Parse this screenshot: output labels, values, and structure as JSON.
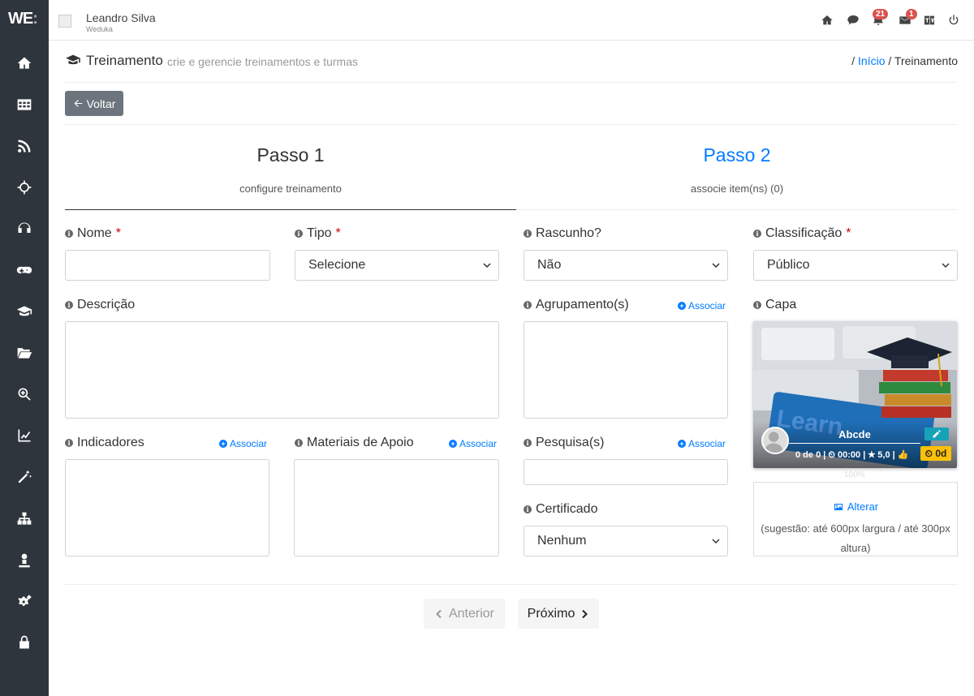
{
  "brand": {
    "logo_text": "WE",
    "logo_dot": ":"
  },
  "user": {
    "name": "Leandro Silva",
    "org": "Weduka"
  },
  "topbar": {
    "icons": [
      "home-icon",
      "chat-icon",
      "bell-icon",
      "mail-icon",
      "translate-icon",
      "power-icon"
    ],
    "notifications_count": "21",
    "messages_count": "1"
  },
  "sidebar": {
    "icons": [
      "home-icon",
      "table-icon",
      "rss-icon",
      "crosshairs-icon",
      "headset-icon",
      "gamepad-icon",
      "graduation-cap-icon",
      "folder-open-icon",
      "search-plus-icon",
      "chart-line-icon",
      "magic-wand-icon",
      "sitemap-icon",
      "user-icon",
      "cogs-icon",
      "lock-icon"
    ]
  },
  "header": {
    "title": "Treinamento",
    "subtitle": "crie e gerencie treinamentos e turmas",
    "breadcrumb_sep": "/",
    "breadcrumb_home": "Início",
    "breadcrumb_current": "Treinamento"
  },
  "back_button": "Voltar",
  "steps": [
    {
      "title": "Passo 1",
      "subtitle": "configure treinamento"
    },
    {
      "title": "Passo 2",
      "subtitle": "associe item(ns) (0)"
    }
  ],
  "form": {
    "nome_label": "Nome",
    "tipo_label": "Tipo",
    "tipo_value": "Selecione",
    "rascunho_label": "Rascunho?",
    "rascunho_value": "Não",
    "classificacao_label": "Classificação",
    "classificacao_value": "Público",
    "descricao_label": "Descrição",
    "agrupamento_label": "Agrupamento(s)",
    "capa_label": "Capa",
    "indicadores_label": "Indicadores",
    "materiais_label": "Materiais de Apoio",
    "pesquisa_label": "Pesquisa(s)",
    "certificado_label": "Certificado",
    "certificado_value": "Nenhum",
    "associar": "Associar",
    "required_mark": "*"
  },
  "cover": {
    "course_name": "Abcde",
    "meta": "0 de 0 | ⏲ 00:00 | ★ 5,0 | 👍",
    "time_badge": "⏲ 0d",
    "progress": "100%",
    "image_word": "Learn"
  },
  "alterar": {
    "label": "Alterar",
    "hint": "(sugestão: até 600px largura / até 300px altura)"
  },
  "nav": {
    "prev": "Anterior",
    "next": "Próximo"
  },
  "colors": {
    "sidebar": "#2f353d",
    "accent": "#007bff",
    "badge": "#d9534f",
    "warning": "#ffc107",
    "info": "#17a2b8"
  }
}
